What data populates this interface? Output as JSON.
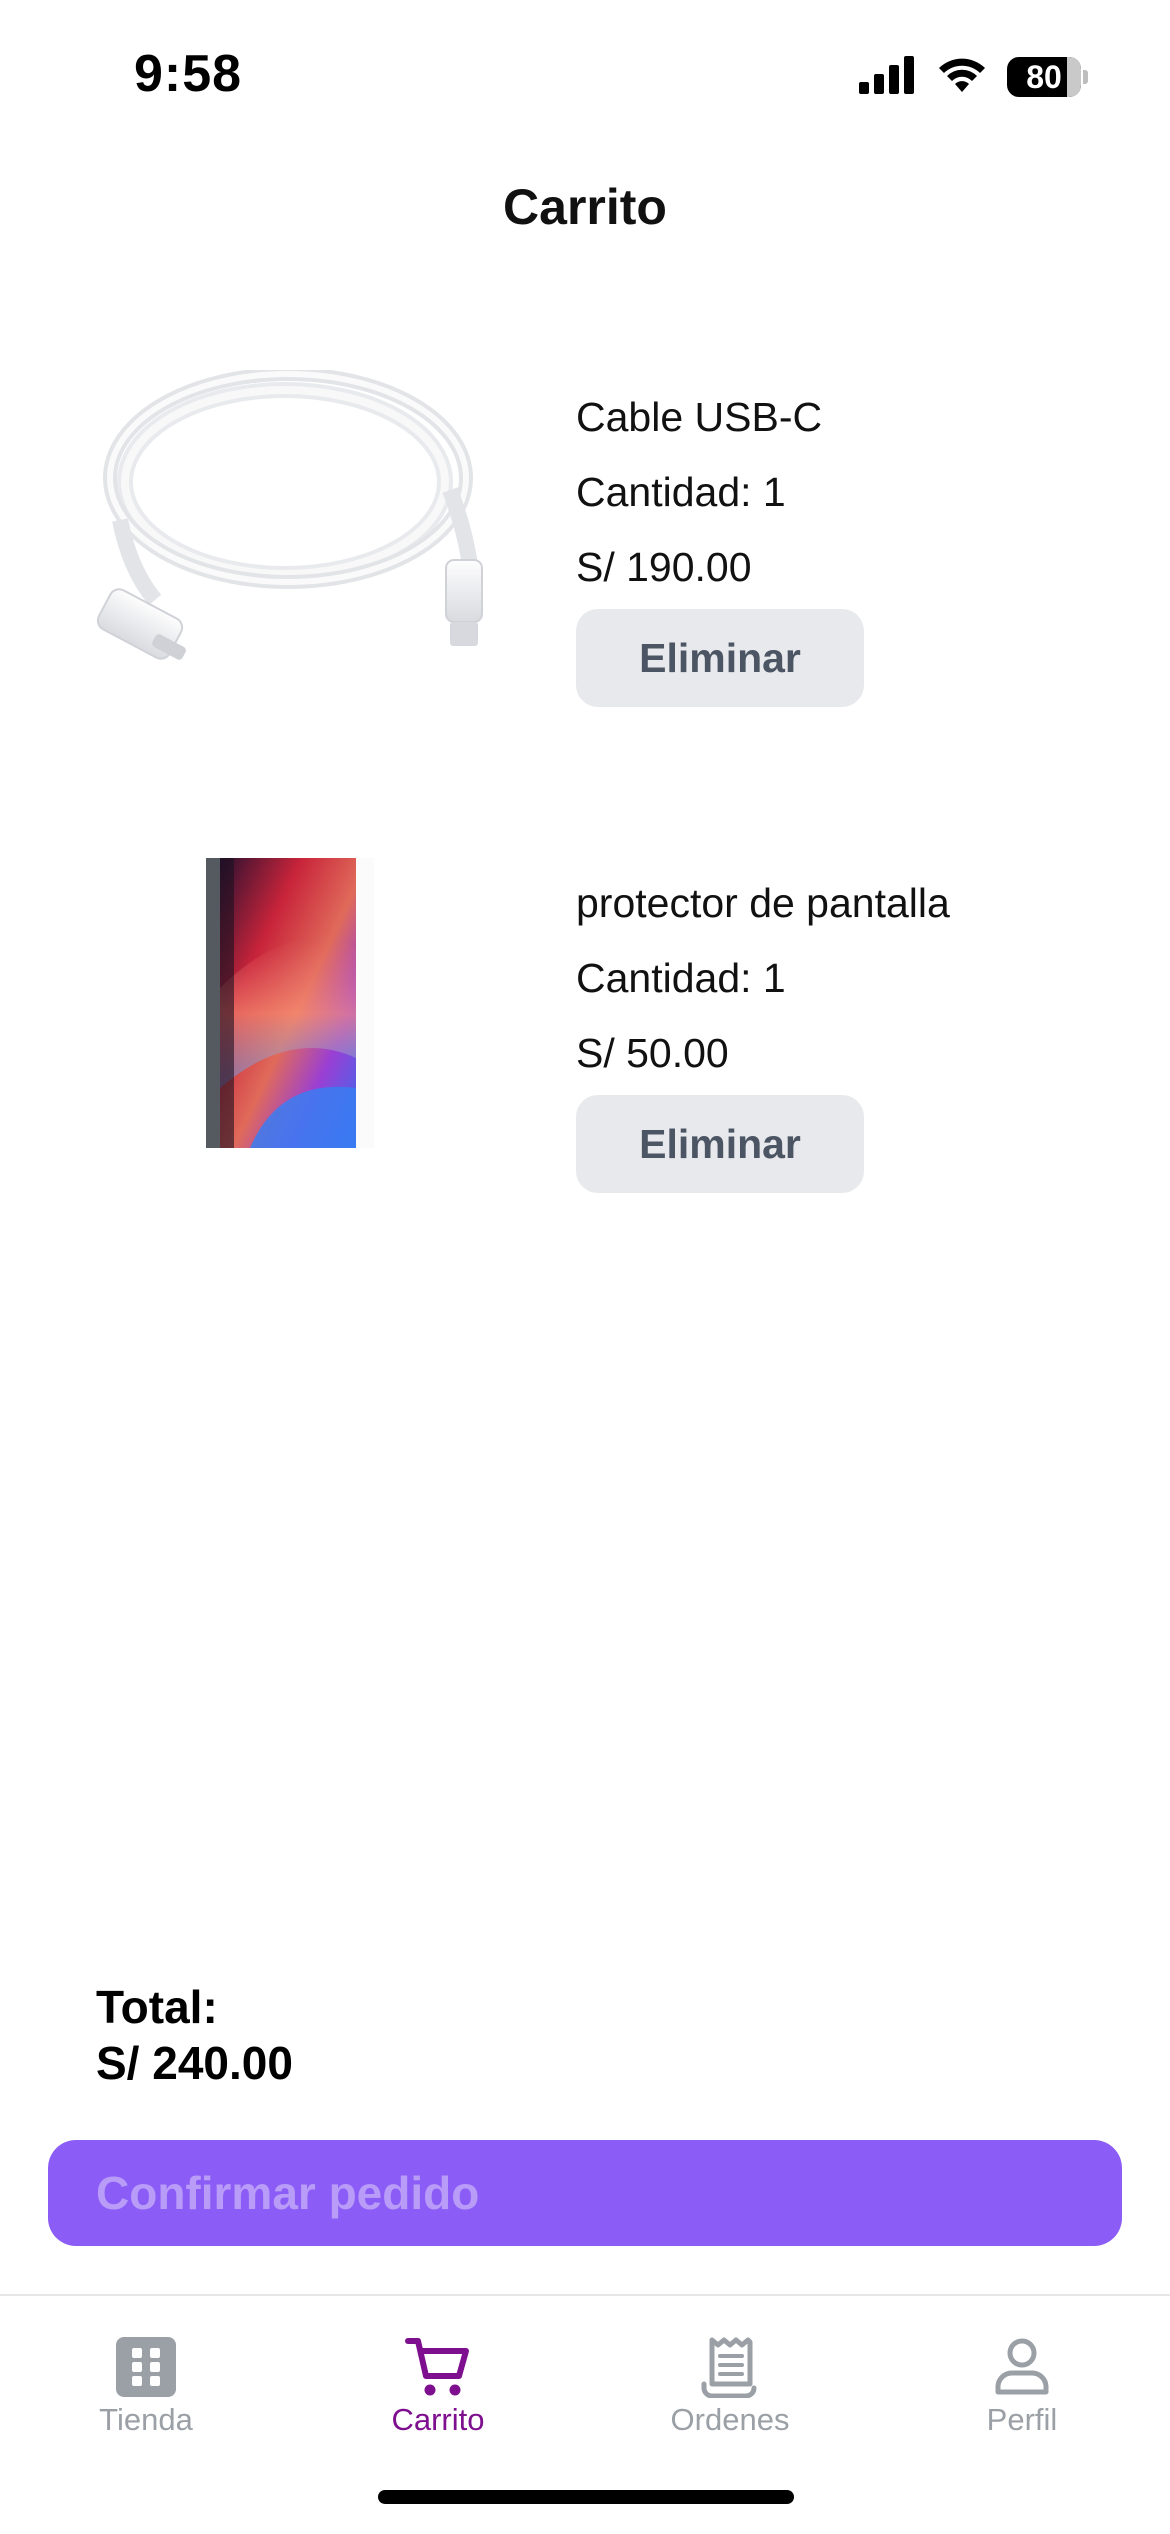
{
  "status_bar": {
    "time": "9:58",
    "battery": "80",
    "icons": [
      "cellular-signal-icon",
      "wifi-icon",
      "battery-icon"
    ]
  },
  "header": {
    "title": "Carrito"
  },
  "cart": {
    "items": [
      {
        "name": "Cable USB-C",
        "quantity": "Cantidad: 1",
        "price": "S/ 190.00",
        "remove_label": "Eliminar",
        "image": "usb-c-cable"
      },
      {
        "name": "protector de pantalla",
        "quantity": "Cantidad: 1",
        "price": "S/ 50.00",
        "remove_label": "Eliminar",
        "image": "screen-protector"
      }
    ],
    "total_label": "Total:",
    "total_value": "S/ 240.00",
    "confirm_label": "Confirmar pedido"
  },
  "tab_bar": {
    "tabs": [
      {
        "label": "Tienda",
        "icon": "grid-icon",
        "active": false
      },
      {
        "label": "Carrito",
        "icon": "cart-icon",
        "active": true
      },
      {
        "label": "Ordenes",
        "icon": "receipt-icon",
        "active": false
      },
      {
        "label": "Perfil",
        "icon": "person-icon",
        "active": false
      }
    ],
    "active_color": "#7e0f8e",
    "inactive_color": "#9aa0a6"
  },
  "colors": {
    "primary_button": "#8b5cf6",
    "primary_button_text": "#b99cf8",
    "secondary_button": "#e8e9ec",
    "secondary_button_text": "#4b5563"
  }
}
